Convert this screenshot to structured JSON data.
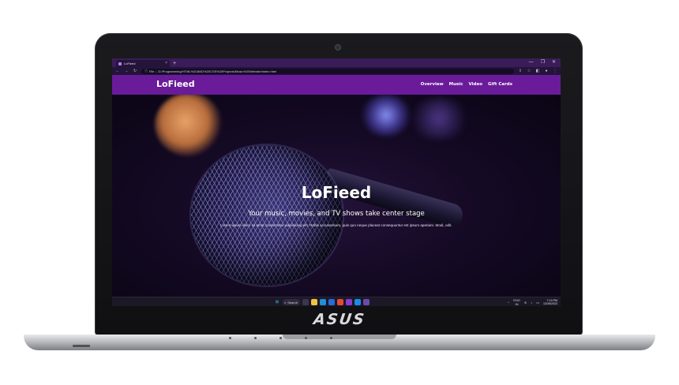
{
  "device": {
    "brand": "ASUS"
  },
  "browser": {
    "tab_title": "LoFieed",
    "tab_close": "×",
    "new_tab": "+",
    "window_controls": [
      "—",
      "❐",
      "✕"
    ],
    "address_prefix": "File",
    "address_separator": "|",
    "url": "D:/Programming/HTML%20AND%20CSS%20Projects/Music%20Website/index.html"
  },
  "site": {
    "logo": "LoFieed",
    "nav": [
      "Overview",
      "Music",
      "Video",
      "Gift Cards"
    ],
    "hero_title": "LoFieed",
    "hero_subtitle": "Your music, movies, and TV shows take center stage",
    "hero_text": "Lorem ipsum dolor sit amet consectetur adipisicing elit. Nobis accusantium, quis quo neque placeat consequuntur est ipsum aperiam. Modi, odit."
  },
  "taskbar": {
    "search_label": "Search",
    "lang_top": "ENG",
    "lang_bottom": "IN",
    "time": "7:19 PM",
    "date": "12/26/2022"
  },
  "colors": {
    "nav_bg": "#6a1b9a",
    "tab_strip": "#3a1c58",
    "toolbar": "#24143a"
  }
}
